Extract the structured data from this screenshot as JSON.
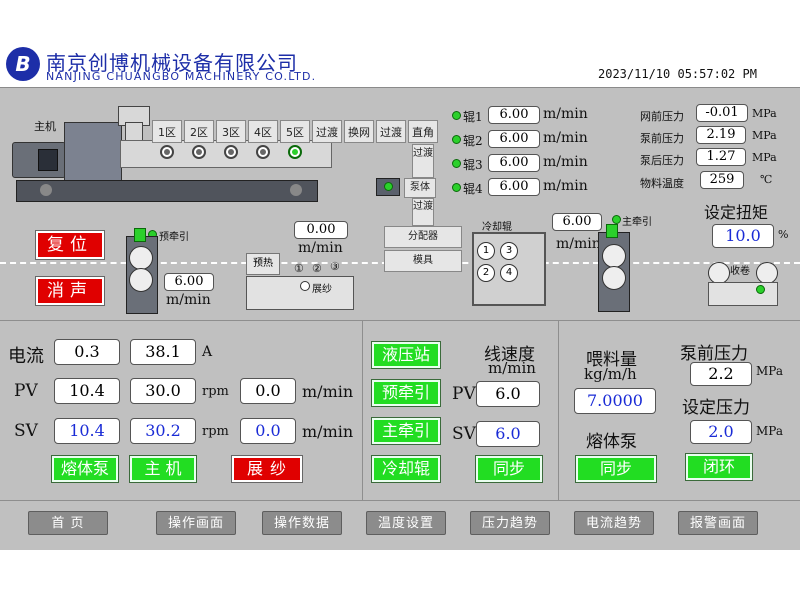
{
  "header": {
    "company_cn": "南京创博机械设备有限公司",
    "company_en": "NANJING CHUANGBO MACHINERY CO.LTD.",
    "datetime": "2023/11/10 05:57:02 PM",
    "logo_letter": "B"
  },
  "machine": {
    "main_label": "主机",
    "zones": [
      "1区",
      "2区",
      "3区",
      "4区",
      "5区",
      "过渡",
      "换网",
      "过渡",
      "直角"
    ],
    "guodu_v1": "过渡",
    "pump_label": "泵体",
    "guodu_v2": "过渡",
    "distributor_label": "分配器",
    "die_label": "模具",
    "pre_tract_label": "预牵引",
    "preheat_label": "预热",
    "spread_label": "展纱",
    "spread_roll_marks": [
      "①",
      "②",
      "③"
    ],
    "cooling_roll_label": "冷却辊",
    "cooling_rolls": [
      "1",
      "3",
      "2",
      "4"
    ],
    "main_tract_label": "主牵引",
    "winder_label": "收卷"
  },
  "rollers": [
    {
      "name": "辊1",
      "value": "6.00",
      "unit": "m/min"
    },
    {
      "name": "辊2",
      "value": "6.00",
      "unit": "m/min"
    },
    {
      "name": "辊3",
      "value": "6.00",
      "unit": "m/min"
    },
    {
      "name": "辊4",
      "value": "6.00",
      "unit": "m/min"
    }
  ],
  "pressures": [
    {
      "label": "网前压力",
      "value": "-0.01",
      "unit": "MPa"
    },
    {
      "label": "泵前压力",
      "value": "2.19",
      "unit": "MPa"
    },
    {
      "label": "泵后压力",
      "value": "1.27",
      "unit": "MPa"
    },
    {
      "label": "物料温度",
      "value": "259",
      "unit": "℃"
    }
  ],
  "torque": {
    "label": "设定扭矩",
    "value": "10.0",
    "unit": "%"
  },
  "speeds": {
    "pre_tract_top": "0.00",
    "pre_tract_top_unit": "m/min",
    "pre_tract_side": "6.00",
    "pre_tract_side_unit": "m/min",
    "main_tract": "6.00",
    "main_tract_unit": "m/min"
  },
  "buttons": {
    "reset": "复位",
    "silence": "消声"
  },
  "params": {
    "current_label": "电流",
    "current_v1": "0.3",
    "current_v2": "38.1",
    "current_unit": "A",
    "pv_label": "PV",
    "pv_v1": "10.4",
    "pv_v2": "30.0",
    "pv_unit_rpm": "rpm",
    "pv_v3": "0.0",
    "pv_unit": "m/min",
    "sv_label": "SV",
    "sv_v1": "10.4",
    "sv_v2": "30.2",
    "sv_unit_rpm": "rpm",
    "sv_v3": "0.0",
    "sv_unit": "m/min",
    "btn_melt_pump": "熔体泵",
    "btn_main": "主 机",
    "btn_spread": "展 纱"
  },
  "middle": {
    "btn_hydraulic": "液压站",
    "btn_pre_tract": "预牵引",
    "btn_main_tract": "主牵引",
    "btn_cooling": "冷却辊",
    "line_speed_label": "线速度",
    "line_speed_unit": "m/min",
    "pv_label": "PV",
    "pv_value": "6.0",
    "sv_label": "SV",
    "sv_value": "6.0",
    "btn_sync": "同步"
  },
  "right": {
    "feed_label": "喂料量",
    "feed_unit": "kg/m/h",
    "feed_value": "7.0000",
    "melt_pump_label": "熔体泵",
    "btn_sync": "同步",
    "pre_pump_label": "泵前压力",
    "pre_pump_value": "2.2",
    "pre_pump_unit": "MPa",
    "set_pressure_label": "设定压力",
    "set_pressure_value": "2.0",
    "set_pressure_unit": "MPa",
    "btn_closed_loop": "闭环"
  },
  "nav": [
    "首 页",
    "操作画面",
    "操作数据",
    "温度设置",
    "压力趋势",
    "电流趋势",
    "报警画面"
  ]
}
